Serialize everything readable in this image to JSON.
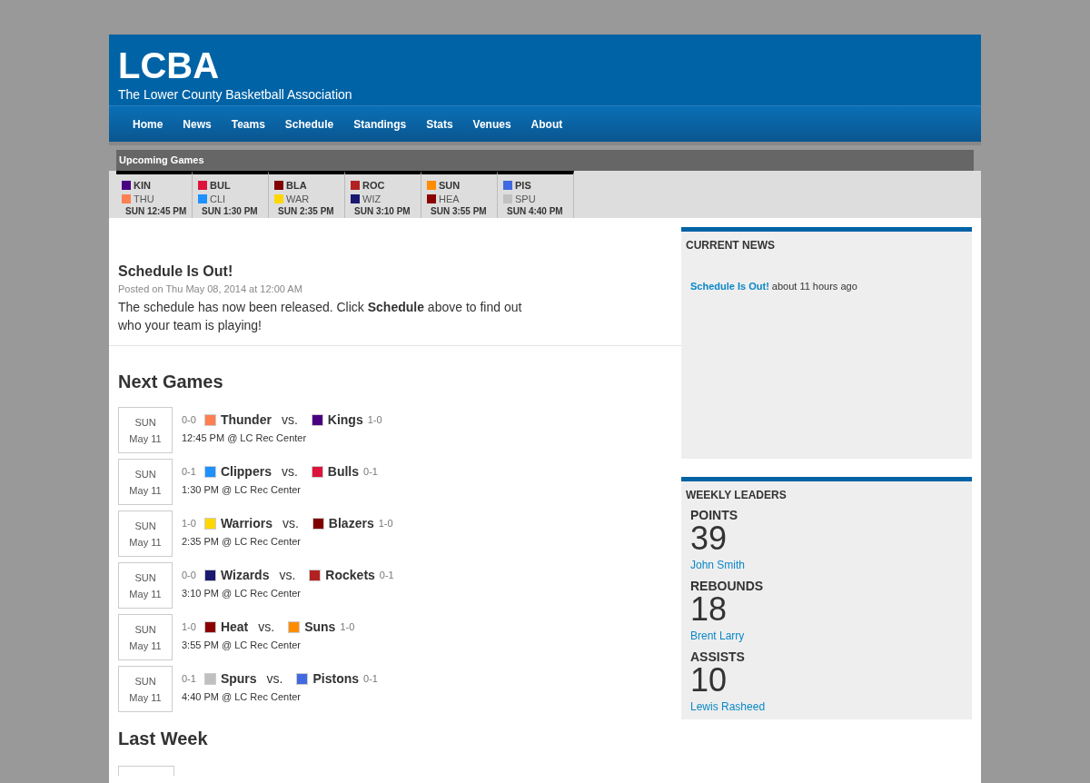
{
  "site": {
    "title": "LCBA",
    "subtitle": "The Lower County Basketball Association"
  },
  "nav": [
    {
      "label": "Home"
    },
    {
      "label": "News"
    },
    {
      "label": "Teams"
    },
    {
      "label": "Schedule"
    },
    {
      "label": "Standings"
    },
    {
      "label": "Stats"
    },
    {
      "label": "Venues"
    },
    {
      "label": "About"
    }
  ],
  "upcoming": {
    "title": "Upcoming Games",
    "games": [
      {
        "home": {
          "abbr": "KIN",
          "color": "#4b0082"
        },
        "away": {
          "abbr": "THU",
          "color": "#ff7f50"
        },
        "time": "SUN 12:45 PM"
      },
      {
        "home": {
          "abbr": "BUL",
          "color": "#dc143c"
        },
        "away": {
          "abbr": "CLI",
          "color": "#1e90ff"
        },
        "time": "SUN 1:30 PM"
      },
      {
        "home": {
          "abbr": "BLA",
          "color": "#800000"
        },
        "away": {
          "abbr": "WAR",
          "color": "#ffd700"
        },
        "time": "SUN 2:35 PM"
      },
      {
        "home": {
          "abbr": "ROC",
          "color": "#b22222"
        },
        "away": {
          "abbr": "WIZ",
          "color": "#191970"
        },
        "time": "SUN 3:10 PM"
      },
      {
        "home": {
          "abbr": "SUN",
          "color": "#ff8c00"
        },
        "away": {
          "abbr": "HEA",
          "color": "#8b0000"
        },
        "time": "SUN 3:55 PM"
      },
      {
        "home": {
          "abbr": "PIS",
          "color": "#4169e1"
        },
        "away": {
          "abbr": "SPU",
          "color": "#c0c0c0"
        },
        "time": "SUN 4:40 PM"
      }
    ]
  },
  "post": {
    "title": "Schedule Is Out!",
    "meta": "Posted on Thu May 08, 2014 at 12:00 AM",
    "body": "The schedule has now been released. Click **Schedule** above to find out who your team is playing!"
  },
  "next_games": {
    "title": "Next Games",
    "games": [
      {
        "day": "SUN",
        "date": "May 11",
        "away": {
          "record": "0-0",
          "name": "Thunder",
          "color": "#ff7f50"
        },
        "vs": "vs.",
        "home": {
          "name": "Kings",
          "color": "#4b0082",
          "record": "1-0"
        },
        "info": "12:45 PM @ LC Rec Center"
      },
      {
        "day": "SUN",
        "date": "May 11",
        "away": {
          "record": "0-1",
          "name": "Clippers",
          "color": "#1e90ff"
        },
        "vs": "vs.",
        "home": {
          "name": "Bulls",
          "color": "#dc143c",
          "record": "0-1"
        },
        "info": "1:30 PM @ LC Rec Center"
      },
      {
        "day": "SUN",
        "date": "May 11",
        "away": {
          "record": "1-0",
          "name": "Warriors",
          "color": "#ffd700"
        },
        "vs": "vs.",
        "home": {
          "name": "Blazers",
          "color": "#800000",
          "record": "1-0"
        },
        "info": "2:35 PM @ LC Rec Center"
      },
      {
        "day": "SUN",
        "date": "May 11",
        "away": {
          "record": "0-0",
          "name": "Wizards",
          "color": "#191970"
        },
        "vs": "vs.",
        "home": {
          "name": "Rockets",
          "color": "#b22222",
          "record": "0-1"
        },
        "info": "3:10 PM @ LC Rec Center"
      },
      {
        "day": "SUN",
        "date": "May 11",
        "away": {
          "record": "1-0",
          "name": "Heat",
          "color": "#8b0000"
        },
        "vs": "vs.",
        "home": {
          "name": "Suns",
          "color": "#ff8c00",
          "record": "1-0"
        },
        "info": "3:55 PM @ LC Rec Center"
      },
      {
        "day": "SUN",
        "date": "May 11",
        "away": {
          "record": "0-1",
          "name": "Spurs",
          "color": "#c0c0c0"
        },
        "vs": "vs.",
        "home": {
          "name": "Pistons",
          "color": "#4169e1",
          "record": "0-1"
        },
        "info": "4:40 PM @ LC Rec Center"
      }
    ]
  },
  "last_week": {
    "title": "Last Week"
  },
  "current_news": {
    "title": "CURRENT NEWS",
    "items": [
      {
        "link": "Schedule Is Out!",
        "age": "about 11 hours ago"
      }
    ]
  },
  "weekly_leaders": {
    "title": "WEEKLY LEADERS",
    "categories": [
      {
        "label": "POINTS",
        "value": "39",
        "player": "John Smith"
      },
      {
        "label": "REBOUNDS",
        "value": "18",
        "player": "Brent Larry"
      },
      {
        "label": "ASSISTS",
        "value": "10",
        "player": "Lewis Rasheed"
      }
    ]
  }
}
